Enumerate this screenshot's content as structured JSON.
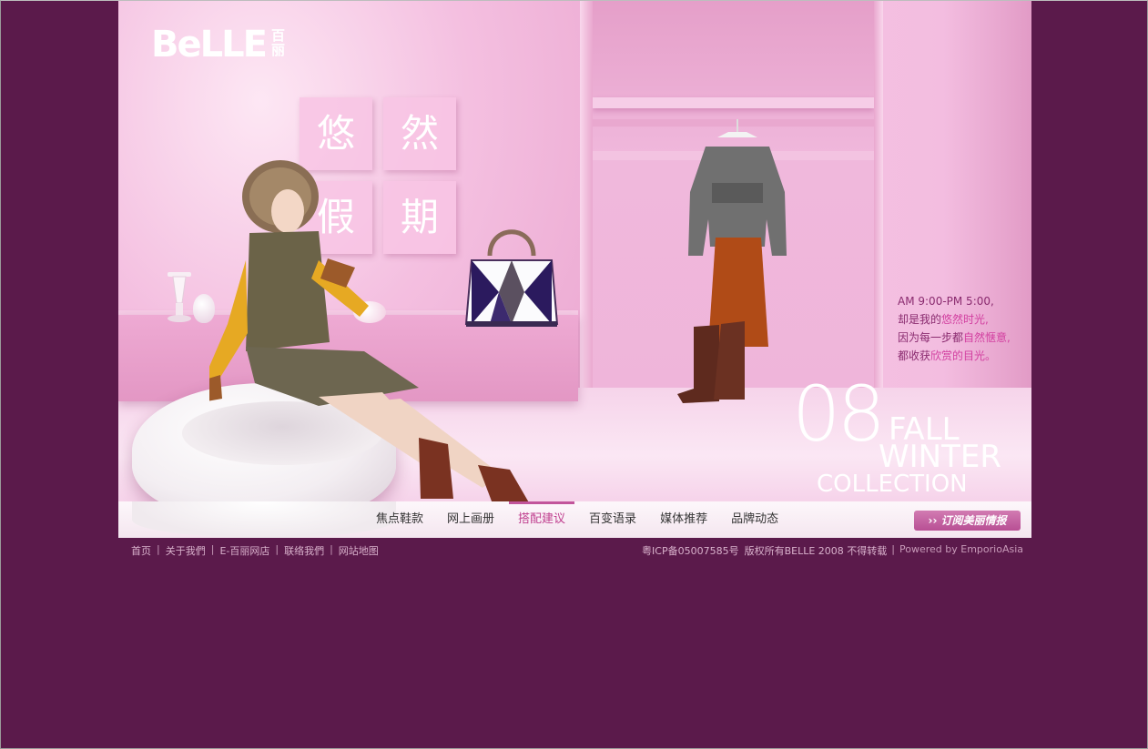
{
  "brand": {
    "logo": "BeLLE",
    "logo_cn": "百丽"
  },
  "hero": {
    "tiles": [
      "悠",
      "然",
      "假",
      "期"
    ],
    "tagline": {
      "line1": "AM 9:00-PM 5:00,",
      "line2_pre": "却是我的",
      "line2_hl": "悠然时光,",
      "line3_pre": "因为每一步都",
      "line3_hl": "自然惬意,",
      "line4_pre": "都收获",
      "line4_hl": "欣赏的目光。"
    },
    "collection": {
      "year": "08",
      "fall": "FALL",
      "winter": "WINTER",
      "label": "COLLECTION"
    }
  },
  "nav": {
    "items": [
      {
        "label": "焦点鞋款",
        "active": false
      },
      {
        "label": "网上画册",
        "active": false
      },
      {
        "label": "搭配建议",
        "active": true
      },
      {
        "label": "百变语录",
        "active": false
      },
      {
        "label": "媒体推荐",
        "active": false
      },
      {
        "label": "品牌动态",
        "active": false
      }
    ],
    "subscribe_label": "订阅美丽情报",
    "subscribe_arrow": "››"
  },
  "footer": {
    "links": [
      "首页",
      "关于我們",
      "E-百丽网店",
      "联络我們",
      "网站地图"
    ],
    "icp": "粤ICP备05007585号",
    "copyright": "版权所有BELLE 2008 不得转载",
    "powered": "Powered by  EmporioAsia"
  },
  "colors": {
    "background": "#5b1a4b",
    "accent": "#c0408f",
    "hero_pink": "#f1b8dc"
  }
}
